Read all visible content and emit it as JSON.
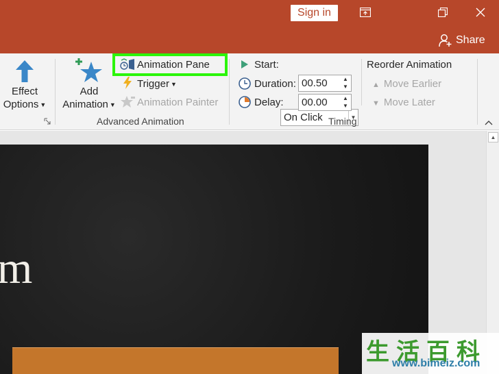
{
  "titlebar": {
    "signin_label": "Sign in",
    "share_label": "Share",
    "bg_color": "#b7472a"
  },
  "ribbon": {
    "effect_options": {
      "line1": "Effect",
      "line2": "Options"
    },
    "add_animation": {
      "line1": "Add",
      "line2": "Animation"
    },
    "animation_pane_label": "Animation Pane",
    "trigger_label": "Trigger",
    "animation_painter_label": "Animation Painter",
    "advanced_animation_group": "Advanced Animation",
    "timing": {
      "start_label": "Start:",
      "start_value": "On Click",
      "duration_label": "Duration:",
      "duration_value": "00.50",
      "delay_label": "Delay:",
      "delay_value": "00.00",
      "group_label": "Timing"
    },
    "reorder": {
      "title": "Reorder Animation",
      "move_earlier": "Move Earlier",
      "move_later": "Move Later"
    },
    "highlight_color": "#2cf50a"
  },
  "slide": {
    "visible_text": "m"
  },
  "watermark": {
    "chinese": "生活百科",
    "url": "www.bimeiz.com"
  }
}
